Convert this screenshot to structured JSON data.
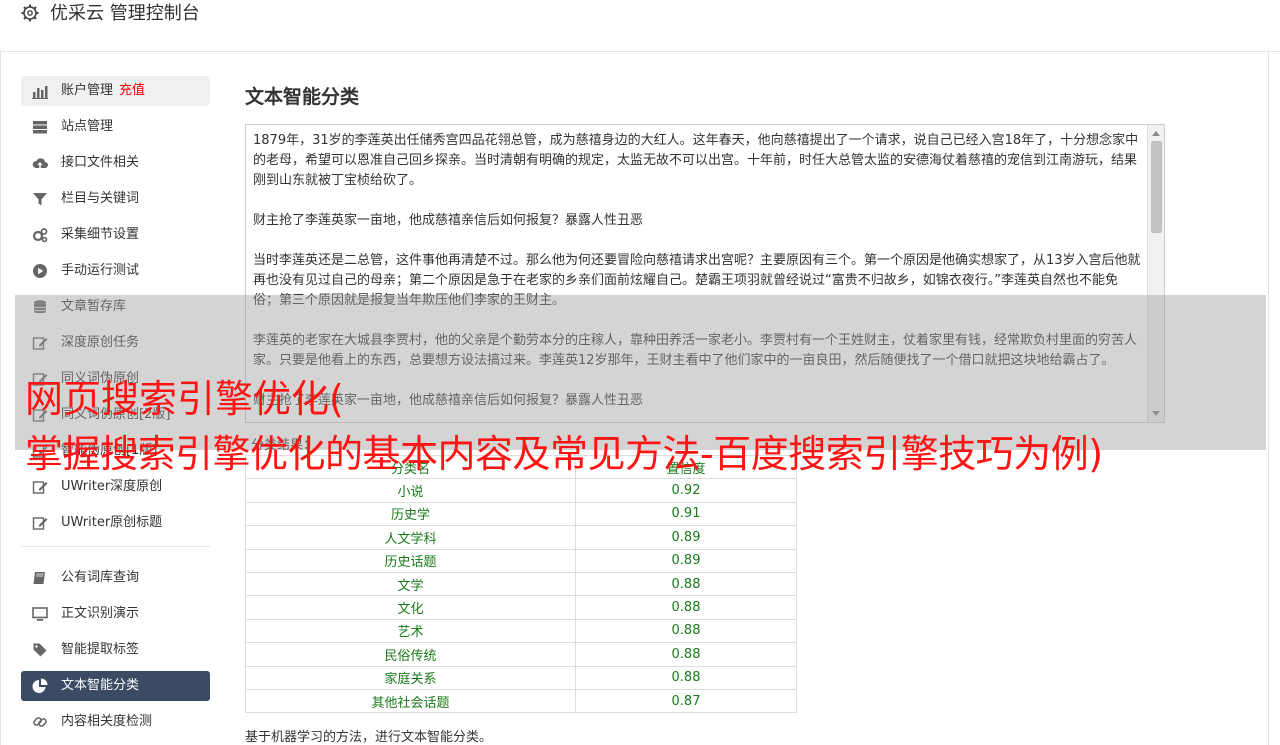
{
  "header": {
    "title": "优采云 管理控制台",
    "icon": "gear-icon"
  },
  "sidebar": {
    "group1": [
      {
        "label": "账户管理",
        "tag": "充值",
        "icon": "bar-chart-icon",
        "highlight": true
      },
      {
        "label": "站点管理",
        "icon": "server-icon"
      },
      {
        "label": "接口文件相关",
        "icon": "cloud-upload-icon"
      },
      {
        "label": "栏目与关键词",
        "icon": "filter-icon"
      },
      {
        "label": "采集细节设置",
        "icon": "gears-icon"
      },
      {
        "label": "手动运行测试",
        "icon": "play-circle-icon"
      },
      {
        "label": "文章暂存库",
        "icon": "database-icon"
      },
      {
        "label": "深度原创任务",
        "icon": "edit-icon"
      },
      {
        "label": "同义词伪原创",
        "icon": "edit-icon"
      },
      {
        "label": "同义词伪原创[2版]",
        "icon": "edit-icon"
      },
      {
        "label": "智能伪原创[1版]",
        "icon": "edit-icon"
      },
      {
        "label": "UWriter深度原创",
        "icon": "edit-icon"
      },
      {
        "label": "UWriter原创标题",
        "icon": "edit-icon"
      }
    ],
    "group2": [
      {
        "label": "公有词库查询",
        "icon": "book-icon"
      },
      {
        "label": "正文识别演示",
        "icon": "monitor-icon"
      },
      {
        "label": "智能提取标签",
        "icon": "tag-icon"
      },
      {
        "label": "文本智能分类",
        "icon": "pie-chart-icon",
        "active": true
      },
      {
        "label": "内容相关度检测",
        "icon": "link-icon"
      }
    ]
  },
  "main": {
    "heading": "文本智能分类",
    "text_paragraphs": [
      "1879年，31岁的李莲英出任储秀宫四品花翎总管，成为慈禧身边的大红人。这年春天，他向慈禧提出了一个请求，说自己已经入宫18年了，十分想念家中的老母，希望可以恩准自己回乡探亲。当时清朝有明确的规定，太监无故不可以出宫。十年前，时任大总管太监的安德海仗着慈禧的宠信到江南游玩，结果刚到山东就被丁宝桢给砍了。",
      "财主抢了李莲英家一亩地，他成慈禧亲信后如何报复？暴露人性丑恶",
      "当时李莲英还是二总管，这件事他再清楚不过。那么他为何还要冒险向慈禧请求出宫呢？主要原因有三个。第一个原因是他确实想家了，从13岁入宫后他就再也没有见过自己的母亲；第二个原因是急于在老家的乡亲们面前炫耀自己。楚霸王项羽就曾经说过“富贵不归故乡，如锦衣夜行。”李莲英自然也不能免俗；第三个原因就是报复当年欺压他们李家的王财主。",
      "李莲英的老家在大城县李贾村，他的父亲是个勤劳本分的庄稼人，靠种田养活一家老小。李贾村有一个王姓财主，仗着家里有钱，经常欺负村里面的穷苦人家。只要是他看上的东西，总要想方设法搞过来。李莲英12岁那年，王财主看中了他们家中的一亩良田，然后随便找了一个借口就把这块地给霸占了。",
      "财主抢了李莲英家一亩地，他成慈禧亲信后如何报复？暴露人性丑恶"
    ],
    "result_label": "分类结果：",
    "table": {
      "headers": [
        "分类名",
        "置信度"
      ],
      "rows": [
        [
          "小说",
          "0.92"
        ],
        [
          "历史学",
          "0.91"
        ],
        [
          "人文学科",
          "0.89"
        ],
        [
          "历史话题",
          "0.89"
        ],
        [
          "文学",
          "0.88"
        ],
        [
          "文化",
          "0.88"
        ],
        [
          "艺术",
          "0.88"
        ],
        [
          "民俗传统",
          "0.88"
        ],
        [
          "家庭关系",
          "0.88"
        ],
        [
          "其他社会话题",
          "0.87"
        ]
      ]
    },
    "footer_note": "基于机器学习的方法，进行文本智能分类。"
  },
  "overlay": {
    "line1": "网页搜索引擎优化(",
    "line2": "掌握搜索引擎优化的基本内容及常见方法-百度搜索引擎技巧为例)"
  },
  "colors": {
    "accent": "#3a4b63",
    "overlay_text": "#ff1414",
    "result_text": "#1a7a1a",
    "tag": "#ee0000"
  }
}
